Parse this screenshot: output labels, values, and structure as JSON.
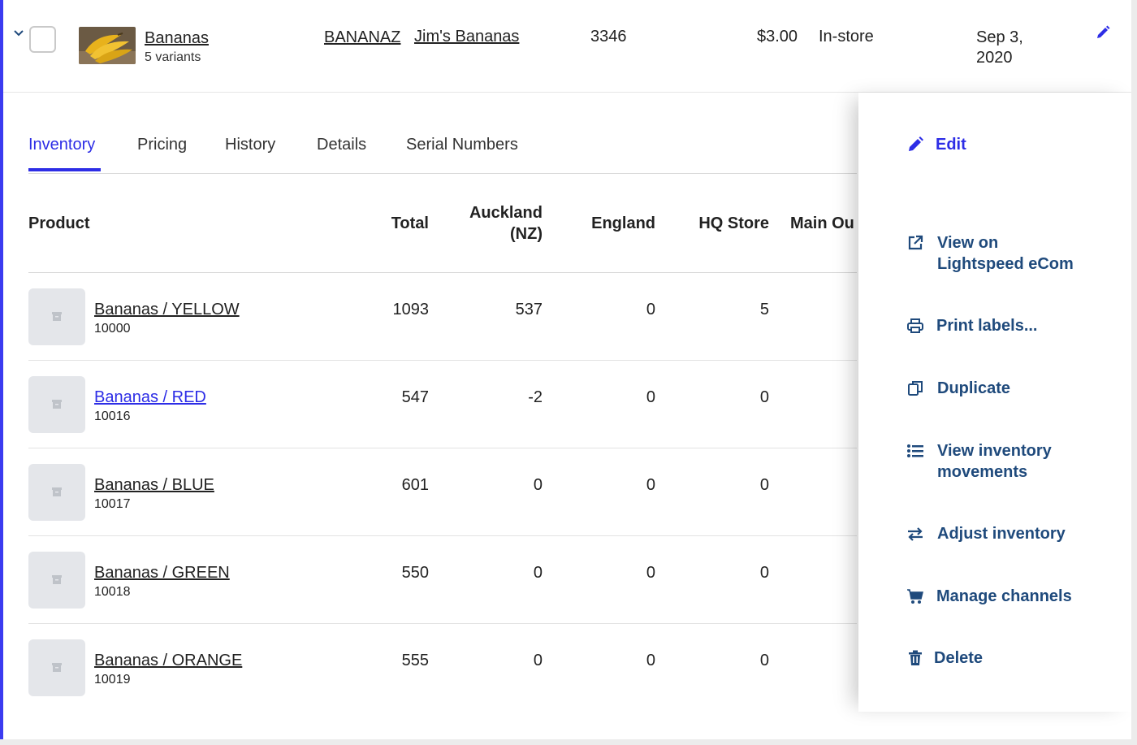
{
  "product": {
    "name": "Bananas",
    "variants_label": "5 variants",
    "sku": "BANANAZ",
    "brand": "Jim's Bananas",
    "code": "3346",
    "price": "$3.00",
    "channel": "In-store",
    "date": "Sep 3, 2020"
  },
  "tabs": [
    {
      "label": "Inventory",
      "active": true
    },
    {
      "label": "Pricing"
    },
    {
      "label": "History"
    },
    {
      "label": "Details"
    },
    {
      "label": "Serial Numbers"
    }
  ],
  "table": {
    "headers": {
      "product": "Product",
      "total": "Total",
      "auckland_line1": "Auckland",
      "auckland_line2": "(NZ)",
      "england": "England",
      "hq": "HQ Store",
      "main": "Main Ou"
    },
    "rows": [
      {
        "name": "Bananas / YELLOW",
        "sku": "10000",
        "total": "1093",
        "auckland": "537",
        "england": "0",
        "hq": "5"
      },
      {
        "name": "Bananas / RED",
        "sku": "10016",
        "total": "547",
        "auckland": "-2",
        "england": "0",
        "hq": "0"
      },
      {
        "name": "Bananas / BLUE",
        "sku": "10017",
        "total": "601",
        "auckland": "0",
        "england": "0",
        "hq": "0"
      },
      {
        "name": "Bananas / GREEN",
        "sku": "10018",
        "total": "550",
        "auckland": "0",
        "england": "0",
        "hq": "0"
      },
      {
        "name": "Bananas / ORANGE",
        "sku": "10019",
        "total": "555",
        "auckland": "0",
        "england": "0",
        "hq": "0"
      }
    ]
  },
  "menu": {
    "edit": "Edit",
    "view_on_line1": "View on",
    "view_on_line2": "Lightspeed eCom",
    "print_labels": "Print labels...",
    "duplicate": "Duplicate",
    "view_inventory_line1": "View inventory",
    "view_inventory_line2": "movements",
    "adjust_inventory": "Adjust inventory",
    "manage_channels": "Manage channels",
    "delete": "Delete"
  },
  "colors": {
    "accent": "#2d2de6",
    "menu_text": "#1f4a7c",
    "left_border": "#3b3bf0"
  }
}
